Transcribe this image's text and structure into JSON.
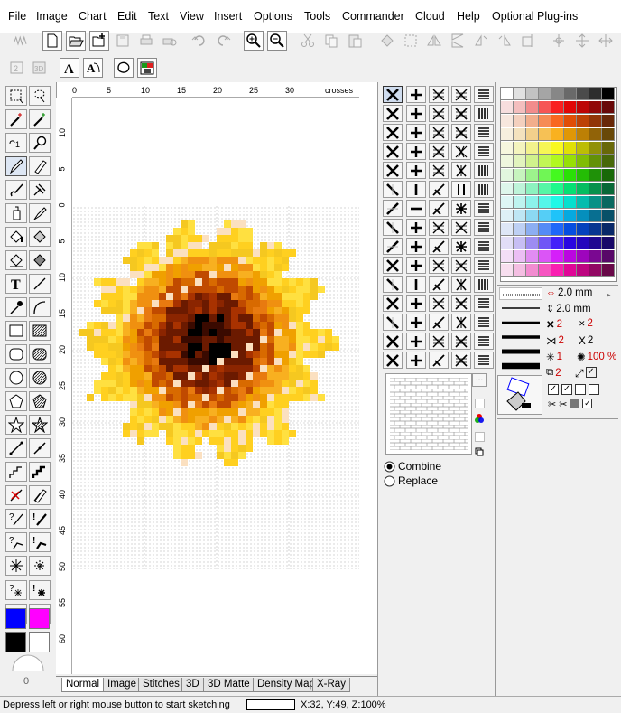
{
  "menu": [
    "File",
    "Image",
    "Chart",
    "Edit",
    "Text",
    "View",
    "Insert",
    "Options",
    "Tools",
    "Commander",
    "Cloud",
    "Help",
    "Optional Plug-ins"
  ],
  "ruler": {
    "h": [
      "0",
      "5",
      "10",
      "15",
      "20",
      "25",
      "30",
      "crosses"
    ],
    "v": [
      "10",
      "5",
      "0",
      "5",
      "10",
      "15",
      "20",
      "25",
      "30",
      "35",
      "40",
      "45",
      "50",
      "55",
      "60"
    ]
  },
  "rotation_value": "0",
  "tabs": [
    "Normal",
    "Image",
    "Stitches",
    "3D",
    "3D Matte",
    "Density Map",
    "X-Ray"
  ],
  "status": {
    "message": "Depress left or right mouse button to start sketching",
    "coords": "X:32, Y:49, Z:100%"
  },
  "combine_label": "Combine",
  "replace_label": "Replace",
  "line": {
    "w1": "2.0 mm",
    "w2": "2.0 mm",
    "n1": "2",
    "n2": "2",
    "n3": "2",
    "n4": "2",
    "n5": "1",
    "pct": "100 %",
    "n6": "2"
  },
  "colors": {
    "fg1": "#0000ff",
    "fg2": "#ff00ff",
    "bg1": "#000000",
    "bg2": "#ffffff",
    "selected": "#000000"
  },
  "icons": [
    "new-icon",
    "open-icon",
    "add-icon",
    "save-icon",
    "print-icon",
    "copy-print-icon",
    "undo-icon",
    "redo-icon",
    "zoom-in-icon",
    "zoom-out-icon"
  ]
}
